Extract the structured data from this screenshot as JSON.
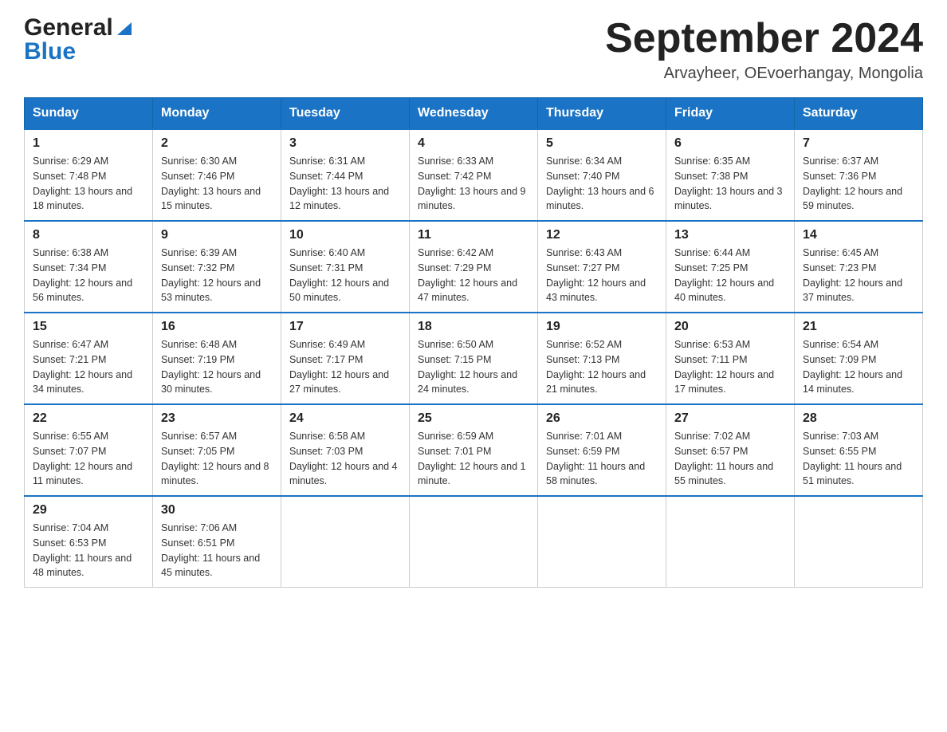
{
  "header": {
    "logo_general": "General",
    "logo_blue": "Blue",
    "title": "September 2024",
    "subtitle": "Arvayheer, OEvoerhangay, Mongolia"
  },
  "days_of_week": [
    "Sunday",
    "Monday",
    "Tuesday",
    "Wednesday",
    "Thursday",
    "Friday",
    "Saturday"
  ],
  "weeks": [
    [
      {
        "day": "1",
        "sunrise": "6:29 AM",
        "sunset": "7:48 PM",
        "daylight": "13 hours and 18 minutes."
      },
      {
        "day": "2",
        "sunrise": "6:30 AM",
        "sunset": "7:46 PM",
        "daylight": "13 hours and 15 minutes."
      },
      {
        "day": "3",
        "sunrise": "6:31 AM",
        "sunset": "7:44 PM",
        "daylight": "13 hours and 12 minutes."
      },
      {
        "day": "4",
        "sunrise": "6:33 AM",
        "sunset": "7:42 PM",
        "daylight": "13 hours and 9 minutes."
      },
      {
        "day": "5",
        "sunrise": "6:34 AM",
        "sunset": "7:40 PM",
        "daylight": "13 hours and 6 minutes."
      },
      {
        "day": "6",
        "sunrise": "6:35 AM",
        "sunset": "7:38 PM",
        "daylight": "13 hours and 3 minutes."
      },
      {
        "day": "7",
        "sunrise": "6:37 AM",
        "sunset": "7:36 PM",
        "daylight": "12 hours and 59 minutes."
      }
    ],
    [
      {
        "day": "8",
        "sunrise": "6:38 AM",
        "sunset": "7:34 PM",
        "daylight": "12 hours and 56 minutes."
      },
      {
        "day": "9",
        "sunrise": "6:39 AM",
        "sunset": "7:32 PM",
        "daylight": "12 hours and 53 minutes."
      },
      {
        "day": "10",
        "sunrise": "6:40 AM",
        "sunset": "7:31 PM",
        "daylight": "12 hours and 50 minutes."
      },
      {
        "day": "11",
        "sunrise": "6:42 AM",
        "sunset": "7:29 PM",
        "daylight": "12 hours and 47 minutes."
      },
      {
        "day": "12",
        "sunrise": "6:43 AM",
        "sunset": "7:27 PM",
        "daylight": "12 hours and 43 minutes."
      },
      {
        "day": "13",
        "sunrise": "6:44 AM",
        "sunset": "7:25 PM",
        "daylight": "12 hours and 40 minutes."
      },
      {
        "day": "14",
        "sunrise": "6:45 AM",
        "sunset": "7:23 PM",
        "daylight": "12 hours and 37 minutes."
      }
    ],
    [
      {
        "day": "15",
        "sunrise": "6:47 AM",
        "sunset": "7:21 PM",
        "daylight": "12 hours and 34 minutes."
      },
      {
        "day": "16",
        "sunrise": "6:48 AM",
        "sunset": "7:19 PM",
        "daylight": "12 hours and 30 minutes."
      },
      {
        "day": "17",
        "sunrise": "6:49 AM",
        "sunset": "7:17 PM",
        "daylight": "12 hours and 27 minutes."
      },
      {
        "day": "18",
        "sunrise": "6:50 AM",
        "sunset": "7:15 PM",
        "daylight": "12 hours and 24 minutes."
      },
      {
        "day": "19",
        "sunrise": "6:52 AM",
        "sunset": "7:13 PM",
        "daylight": "12 hours and 21 minutes."
      },
      {
        "day": "20",
        "sunrise": "6:53 AM",
        "sunset": "7:11 PM",
        "daylight": "12 hours and 17 minutes."
      },
      {
        "day": "21",
        "sunrise": "6:54 AM",
        "sunset": "7:09 PM",
        "daylight": "12 hours and 14 minutes."
      }
    ],
    [
      {
        "day": "22",
        "sunrise": "6:55 AM",
        "sunset": "7:07 PM",
        "daylight": "12 hours and 11 minutes."
      },
      {
        "day": "23",
        "sunrise": "6:57 AM",
        "sunset": "7:05 PM",
        "daylight": "12 hours and 8 minutes."
      },
      {
        "day": "24",
        "sunrise": "6:58 AM",
        "sunset": "7:03 PM",
        "daylight": "12 hours and 4 minutes."
      },
      {
        "day": "25",
        "sunrise": "6:59 AM",
        "sunset": "7:01 PM",
        "daylight": "12 hours and 1 minute."
      },
      {
        "day": "26",
        "sunrise": "7:01 AM",
        "sunset": "6:59 PM",
        "daylight": "11 hours and 58 minutes."
      },
      {
        "day": "27",
        "sunrise": "7:02 AM",
        "sunset": "6:57 PM",
        "daylight": "11 hours and 55 minutes."
      },
      {
        "day": "28",
        "sunrise": "7:03 AM",
        "sunset": "6:55 PM",
        "daylight": "11 hours and 51 minutes."
      }
    ],
    [
      {
        "day": "29",
        "sunrise": "7:04 AM",
        "sunset": "6:53 PM",
        "daylight": "11 hours and 48 minutes."
      },
      {
        "day": "30",
        "sunrise": "7:06 AM",
        "sunset": "6:51 PM",
        "daylight": "11 hours and 45 minutes."
      },
      null,
      null,
      null,
      null,
      null
    ]
  ],
  "labels": {
    "sunrise": "Sunrise:",
    "sunset": "Sunset:",
    "daylight": "Daylight:"
  }
}
